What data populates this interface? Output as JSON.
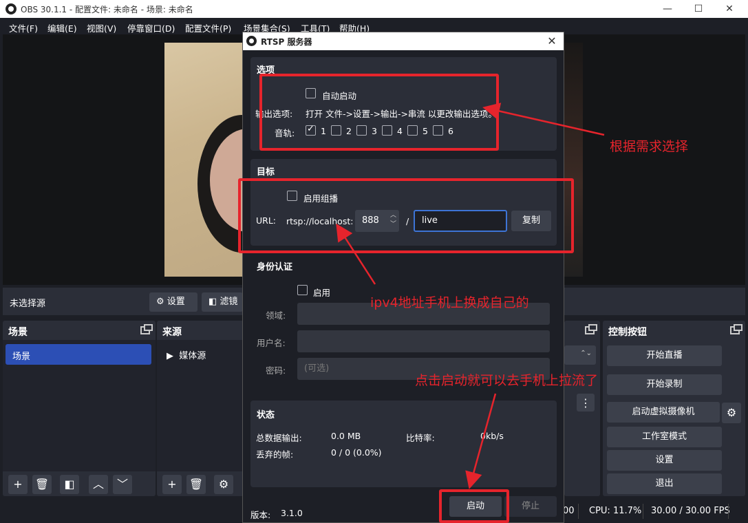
{
  "window": {
    "title": "OBS 30.1.1 - 配置文件: 未命名 - 场景: 未命名",
    "minimize": "—",
    "maximize": "☐",
    "close": "✕"
  },
  "menu": [
    "文件(F)",
    "编辑(E)",
    "视图(V)",
    "停靠窗口(D)",
    "配置文件(P)",
    "场景集合(S)",
    "工具(T)",
    "帮助(H)"
  ],
  "source_bar": {
    "no_source": "未选择源",
    "settings": "设置",
    "filters": "滤镜"
  },
  "docks": {
    "scenes": {
      "title": "场景",
      "items": [
        "场景"
      ]
    },
    "sources": {
      "title": "来源",
      "items": [
        "媒体源"
      ]
    },
    "controls": {
      "title": "控制按钮",
      "start_stream": "开始直播",
      "start_record": "开始录制",
      "virtual_cam": "启动虚拟摄像机",
      "studio_mode": "工作室模式",
      "settings": "设置",
      "exit": "退出"
    }
  },
  "status_bar": {
    "left_fragment": "00",
    "cpu": "CPU: 11.7%",
    "fps": "30.00 / 30.00 FPS"
  },
  "dialog": {
    "title": "RTSP 服务器",
    "close": "✕",
    "options": {
      "title": "选项",
      "auto_start": "自动启动",
      "output_options_label": "输出选项:",
      "output_options_text": "打开 文件->设置->输出->串流 以更改输出选项。",
      "audio_tracks_label": "音轨:",
      "tracks": [
        {
          "label": "1",
          "checked": true
        },
        {
          "label": "2",
          "checked": false
        },
        {
          "label": "3",
          "checked": false
        },
        {
          "label": "4",
          "checked": false
        },
        {
          "label": "5",
          "checked": false
        },
        {
          "label": "6",
          "checked": false
        }
      ]
    },
    "target": {
      "title": "目标",
      "multicast": "启用组播",
      "url_label": "URL:",
      "url_prefix": "rtsp://localhost:",
      "port": "888",
      "slash": "/",
      "path": "live",
      "copy": "复制"
    },
    "auth": {
      "title": "身份认证",
      "enable": "启用",
      "realm_label": "领域:",
      "username_label": "用户名:",
      "password_label": "密码:",
      "password_placeholder": "(可选)"
    },
    "status": {
      "title": "状态",
      "total_output_label": "总数据输出:",
      "total_output": "0.0 MB",
      "bitrate_label": "比特率:",
      "bitrate": "0kb/s",
      "dropped_label": "丢弃的帧:",
      "dropped": "0 / 0 (0.0%)"
    },
    "version_label": "版本:",
    "version": "3.1.0",
    "start": "启动",
    "stop": "停止"
  },
  "annotations": {
    "options_note": "根据需求选择",
    "url_note": "ipv4地址手机上换成自己的",
    "start_note": "点击启动就可以去手机上拉流了",
    "color": "#e6242c"
  }
}
